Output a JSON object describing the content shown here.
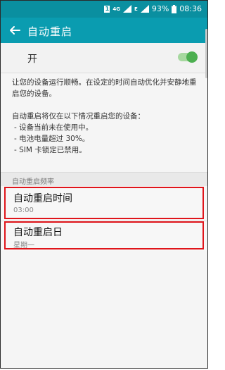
{
  "status_bar": {
    "sim_label": "1",
    "network_label": "4G",
    "data_label": "E",
    "battery": "93%",
    "time": "08:36",
    "icons": [
      "sim-icon",
      "signal-icon",
      "battery-icon"
    ]
  },
  "header": {
    "back_icon": "back-arrow-icon",
    "title": "自动重启"
  },
  "master_switch": {
    "label": "开",
    "on": true,
    "track_color": "#a6d89f",
    "knob_color": "#4caf50"
  },
  "description": {
    "intro": "让您的设备运行顺畅。在设定的时间自动优化并安静地重启您的设备。",
    "conditions_title": "自动重启将仅在以下情况重启您的设备：",
    "conditions": [
      "- 设备当前未在使用中。",
      "- 电池电量超过 30%。",
      "- SIM 卡锁定已禁用。"
    ]
  },
  "section": {
    "label": "自动重启频率"
  },
  "rows": [
    {
      "title": "自动重启时间",
      "value": "03:00"
    },
    {
      "title": "自动重启日",
      "value": "星期一"
    }
  ],
  "colors": {
    "status_bar": "#0a8fa0",
    "header": "#0a9cb0",
    "highlight_border": "#e0151b"
  }
}
